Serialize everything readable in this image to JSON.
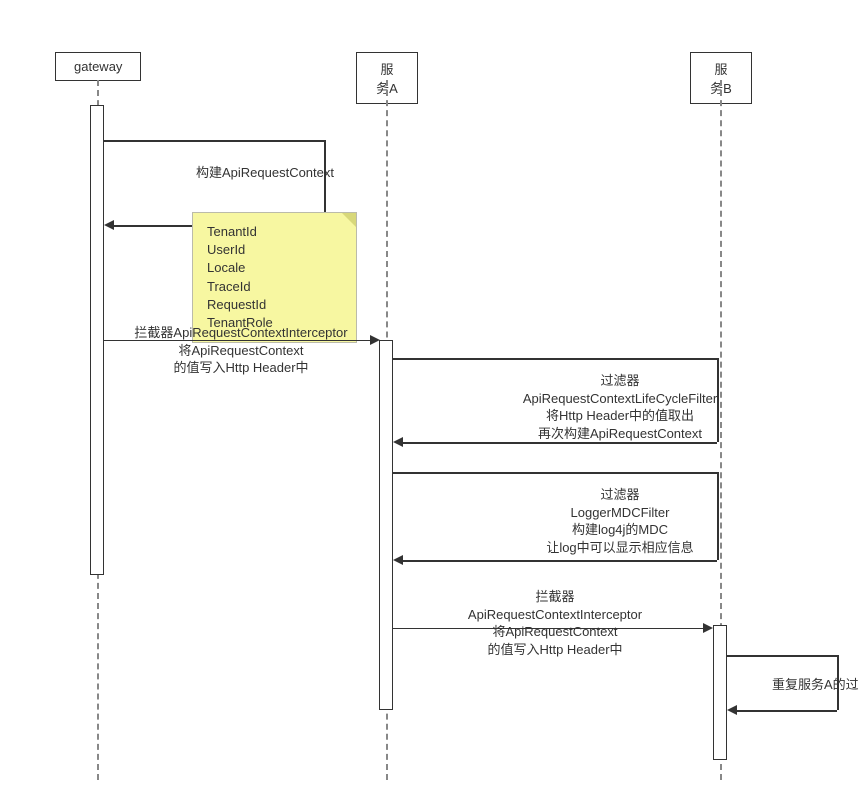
{
  "participants": {
    "gateway": "gateway",
    "serviceA": "服务A",
    "serviceB": "服务B"
  },
  "messages": {
    "m1": "构建ApiRequestContext",
    "m2": "拦截器ApiRequestContextInterceptor\n将ApiRequestContext\n的值写入Http Header中",
    "m3": "过滤器\nApiRequestContextLifeCycleFilter\n将Http Header中的值取出\n再次构建ApiRequestContext",
    "m4": "过滤器\nLoggerMDCFilter\n构建log4j的MDC\n让log中可以显示相应信息",
    "m5": "拦截器\nApiRequestContextInterceptor\n将ApiRequestContext\n的值写入Http Header中",
    "m6": "重复服务A的过"
  },
  "note": {
    "lines": [
      "TenantId",
      "UserId",
      "Locale",
      "TraceId",
      "RequestId",
      "TenantRole"
    ]
  }
}
